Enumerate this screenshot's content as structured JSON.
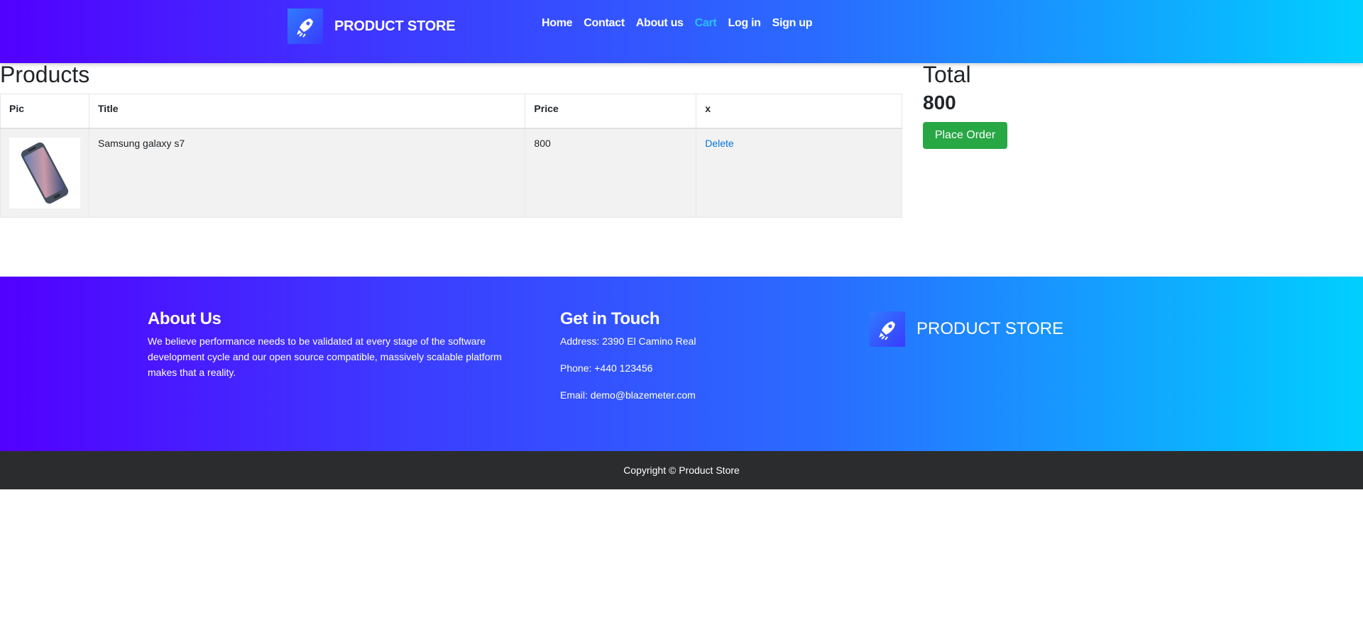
{
  "header": {
    "brand": "PRODUCT STORE",
    "nav": [
      {
        "label": "Home"
      },
      {
        "label": "Contact"
      },
      {
        "label": "About us"
      },
      {
        "label": "Cart"
      },
      {
        "label": "Log in"
      },
      {
        "label": "Sign up"
      }
    ],
    "active_nav": "Cart"
  },
  "products": {
    "heading": "Products",
    "columns": [
      "Pic",
      "Title",
      "Price",
      "x"
    ],
    "rows": [
      {
        "pic": "samsung-galaxy-s7-image",
        "title": "Samsung galaxy s7",
        "price": "800",
        "action": "Delete"
      }
    ]
  },
  "total": {
    "heading": "Total",
    "value": "800",
    "place_order_label": "Place Order"
  },
  "footer": {
    "about_heading": "About Us",
    "about_text": "We believe performance needs to be validated at every stage of the software development cycle and our open source compatible, massively scalable platform makes that a reality.",
    "contact_heading": "Get in Touch",
    "address": "Address: 2390 El Camino Real",
    "phone": "Phone: +440 123456",
    "email": "Email: demo@blazemeter.com",
    "brand": "PRODUCT STORE",
    "copyright": "Copyright © Product Store"
  },
  "colors": {
    "gradient_start": "#5200ff",
    "gradient_end": "#00cfff",
    "active_nav": "#29c1ff",
    "place_order": "#28a745",
    "link": "#0275d8"
  }
}
